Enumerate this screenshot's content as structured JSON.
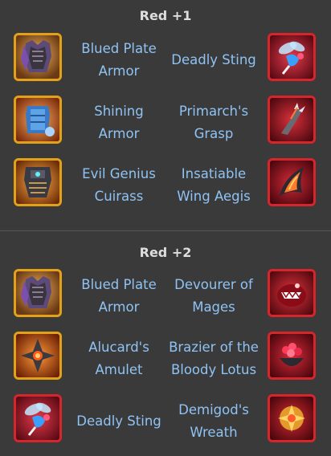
{
  "sections": [
    {
      "title": "Red +1",
      "rows": [
        {
          "left": {
            "name_lines": [
              "Blued Plate",
              "Armor"
            ],
            "icon": "blued-plate-armor-icon",
            "frame": "gold"
          },
          "right": {
            "name_lines": [
              "Deadly Sting"
            ],
            "icon": "deadly-sting-icon",
            "frame": "red"
          }
        },
        {
          "left": {
            "name_lines": [
              "Shining",
              "Armor"
            ],
            "icon": "shining-armor-icon",
            "frame": "gold"
          },
          "right": {
            "name_lines": [
              "Primarch's",
              "Grasp"
            ],
            "icon": "primarchs-grasp-icon",
            "frame": "red"
          }
        },
        {
          "left": {
            "name_lines": [
              "Evil Genius",
              "Cuirass"
            ],
            "icon": "evil-genius-cuirass-icon",
            "frame": "gold"
          },
          "right": {
            "name_lines": [
              "Insatiable",
              "Wing Aegis"
            ],
            "icon": "insatiable-wing-aegis-icon",
            "frame": "red"
          }
        }
      ]
    },
    {
      "title": "Red +2",
      "rows": [
        {
          "left": {
            "name_lines": [
              "Blued Plate",
              "Armor"
            ],
            "icon": "blued-plate-armor-icon",
            "frame": "gold"
          },
          "right": {
            "name_lines": [
              "Devourer of",
              "Mages"
            ],
            "icon": "devourer-of-mages-icon",
            "frame": "red"
          }
        },
        {
          "left": {
            "name_lines": [
              "Alucard's",
              "Amulet"
            ],
            "icon": "alucards-amulet-icon",
            "frame": "gold"
          },
          "right": {
            "name_lines": [
              "Brazier of the",
              "Bloody Lotus"
            ],
            "icon": "brazier-of-the-bloody-lotus-icon",
            "frame": "red"
          }
        },
        {
          "left": {
            "name_lines": [
              "Deadly Sting"
            ],
            "icon": "deadly-sting-icon",
            "frame": "red"
          },
          "right": {
            "name_lines": [
              "Demigod's",
              "Wreath"
            ],
            "icon": "demigods-wreath-icon",
            "frame": "red"
          }
        }
      ]
    }
  ],
  "colors": {
    "background": "#3a3a3a",
    "title": "#dedede",
    "item_name": "#8fc3f4",
    "gold_frame": "#e3a11a",
    "red_frame": "#d7252c"
  }
}
